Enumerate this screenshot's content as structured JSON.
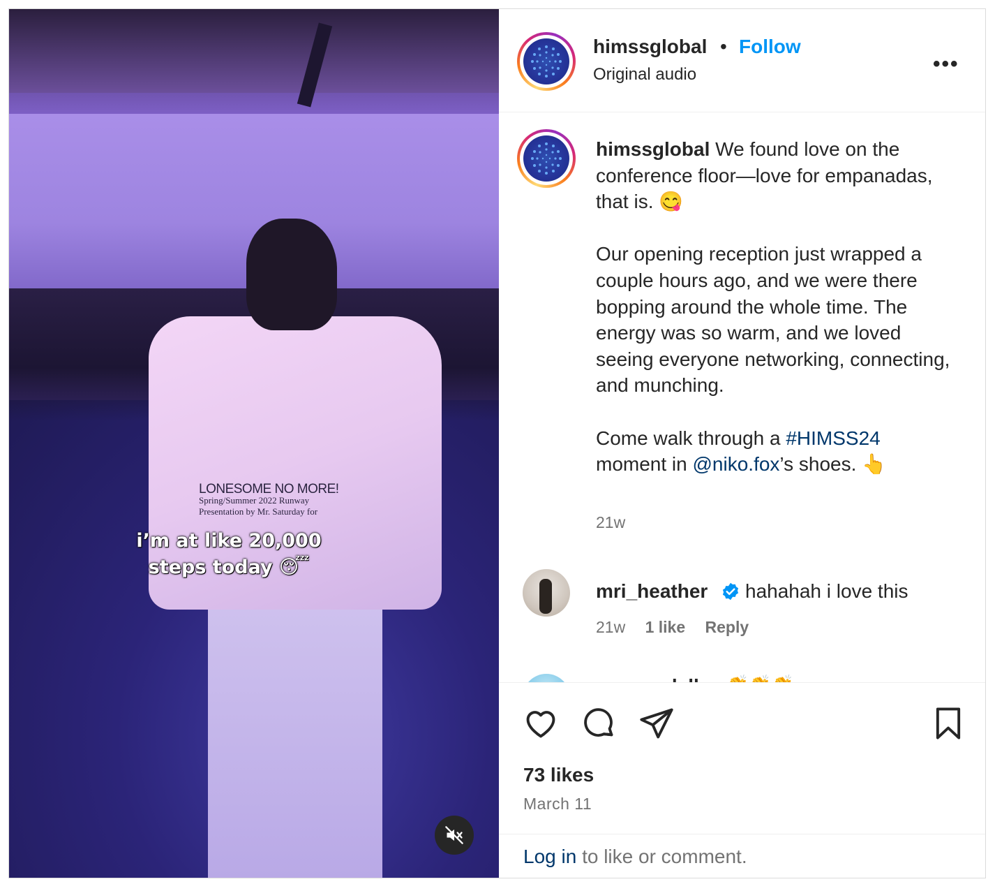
{
  "post": {
    "username": "himssglobal",
    "separator": "•",
    "follow_label": "Follow",
    "audio_label": "Original audio",
    "more_label": "•••",
    "caption": {
      "username": "himssglobal",
      "line1": " We found love on the conference floor—love for empanadas, that is. 😋",
      "para2": "Our opening reception just wrapped a couple hours ago, and we were there bopping around the whole time. The energy was so warm, and we loved seeing everyone networking, connecting, and munching.",
      "para3_pre": "Come walk through a ",
      "hashtag": "#HIMSS24",
      "para3_mid": " moment in ",
      "mention": "@niko.fox",
      "para3_post": "’s shoes. 👆",
      "timestamp": "21w"
    },
    "comments": [
      {
        "username": "mri_heather",
        "verified": true,
        "text": "hahahah i love this",
        "timestamp": "21w",
        "likes": "1 like",
        "reply_label": "Reply"
      },
      {
        "username": "poonamlalka",
        "text": "👏👏👏"
      }
    ],
    "likes": "73 likes",
    "date": "March 11",
    "login_link": "Log in",
    "login_rest": " to like or comment."
  },
  "media": {
    "overlay_line1": "i’m at like 20,000",
    "overlay_line2": "steps today 😴",
    "jacket_title": "LONESOME NO MORE!",
    "jacket_line1": "Spring/Summer 2022 Runway",
    "jacket_line2": "Presentation by Mr. Saturday for",
    "mute_icon": "speaker-muted-icon"
  },
  "colors": {
    "accent": "#0095f6",
    "link": "#00376b",
    "text": "#262626",
    "muted": "#737373",
    "border": "#dbdbdb"
  }
}
